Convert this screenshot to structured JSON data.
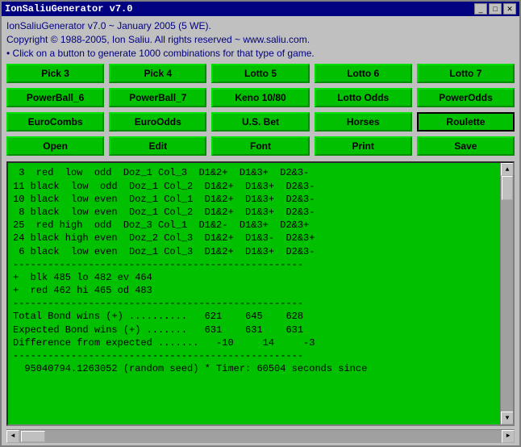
{
  "titleBar": {
    "text": "IonSaliuGenerator v7.0"
  },
  "header": {
    "line1": "IonSaliuGenerator v7.0 ~ January 2005 (5 WE).",
    "line2": "Copyright © 1988-2005, Ion Saliu. All rights reserved ~ www.saliu.com.",
    "line3": "• Click on a button to generate 1000 combinations for that type of game."
  },
  "row1": {
    "btn1": "Pick 3",
    "btn2": "Pick 4",
    "btn3": "Lotto 5",
    "btn4": "Lotto 6",
    "btn5": "Lotto 7"
  },
  "row2": {
    "btn1": "PowerBall_6",
    "btn2": "PowerBall_7",
    "btn3": "Keno 10/80",
    "btn4": "Lotto Odds",
    "btn5": "PowerOdds"
  },
  "row3": {
    "btn1": "EuroCombs",
    "btn2": "EuroOdds",
    "btn3": "U.S. Bet",
    "btn4": "Horses",
    "btn5": "Roulette"
  },
  "row4": {
    "btn1": "Open",
    "btn2": "Edit",
    "btn3": "Font",
    "btn4": "Print",
    "btn5": "Save"
  },
  "output": {
    "text": " 3  red  low  odd  Doz_1 Col_3  D1&2+  D1&3+  D2&3-\n11 black  low  odd  Doz_1 Col_2  D1&2+  D1&3+  D2&3-\n10 black  low even  Doz_1 Col_1  D1&2+  D1&3+  D2&3-\n 8 black  low even  Doz_1 Col_2  D1&2+  D1&3+  D2&3-\n25  red high  odd  Doz_3 Col_1  D1&2-  D1&3+  D2&3+\n24 black high even  Doz_2 Col_3  D1&2+  D1&3-  D2&3+\n 6 black  low even  Doz_1 Col_3  D1&2+  D1&3+  D2&3-\n--------------------------------------------------\n+  blk 485 lo 482 ev 464\n+  red 462 hi 465 od 483\n--------------------------------------------------\nTotal Bond wins (+) ..........   621    645    628\nExpected Bond wins (+) .......   631    631    631\nDifference from expected .......   -10     14     -3\n--------------------------------------------------\n  95040794.1263052 (random seed) * Timer: 60504 seconds since"
  },
  "scrollbar": {
    "up_arrow": "▲",
    "down_arrow": "▼",
    "left_arrow": "◄",
    "right_arrow": "►"
  }
}
